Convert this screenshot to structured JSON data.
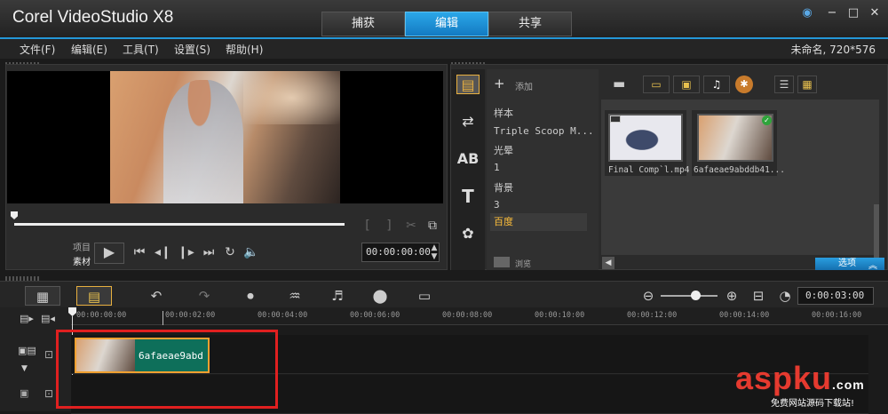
{
  "app": {
    "title": "Corel VideoStudio X8",
    "project_info": "未命名, 720*576"
  },
  "tabs": [
    {
      "label": "捕获",
      "active": false
    },
    {
      "label": "编辑",
      "active": true
    },
    {
      "label": "共享",
      "active": false
    }
  ],
  "window_controls": [
    "globe-icon",
    "minimize-icon",
    "maximize-icon",
    "close-icon"
  ],
  "menu": [
    "文件(F)",
    "编辑(E)",
    "工具(T)",
    "设置(S)",
    "帮助(H)"
  ],
  "player": {
    "mode_project": "项目",
    "mode_clip": "素材",
    "timecode": "00:00:00:00",
    "mark_in": "[",
    "mark_out": "]"
  },
  "library": {
    "add_label": "添加",
    "folders": [
      "样本",
      "Triple Scoop M...",
      "光晕",
      "1",
      "背景",
      "3",
      "百度"
    ],
    "selected_folder": "百度",
    "browse_label": "浏览",
    "thumbnails": [
      {
        "caption": "Final Comp`l.mp4"
      },
      {
        "caption": "6afaeae9abddb41..."
      }
    ],
    "options_label": "选项"
  },
  "timeline": {
    "duration": "0:00:03:00",
    "ruler_ticks": [
      "00:00:00:00",
      "00:00:02:00",
      "00:00:04:00",
      "00:00:06:00",
      "00:00:08:00",
      "00:00:10:00",
      "00:00:12:00",
      "00:00:14:00",
      "00:00:16:00"
    ],
    "clip_label": "6afaeae9abd"
  },
  "watermark": {
    "main": "aspku",
    "suffix": ".com",
    "sub": "免费网站源码下载站!"
  },
  "colors": {
    "accent": "#2497d8",
    "selected_folder": "#ffbf3a",
    "highlight_box": "#e02020",
    "clip": "#0e6f5a"
  }
}
